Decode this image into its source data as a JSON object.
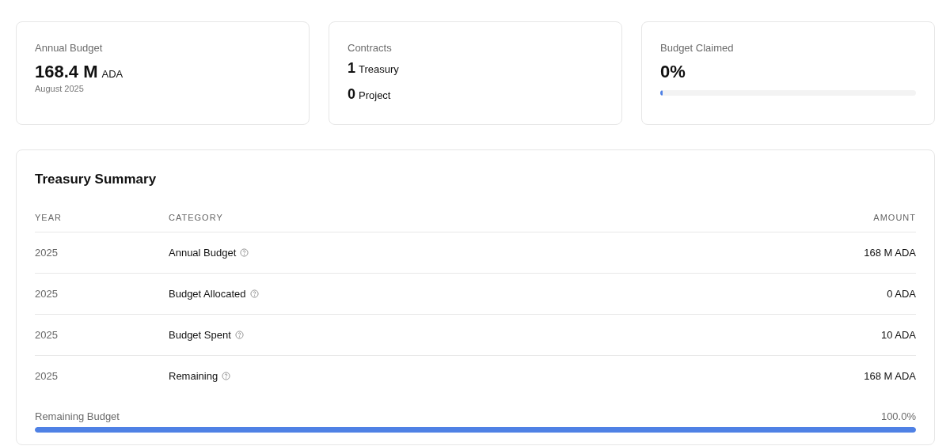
{
  "stats": [
    {
      "kind": "amount",
      "title": "Annual Budget",
      "value": "168.4 M",
      "unit": "ADA",
      "note": "August 2025"
    },
    {
      "kind": "counts",
      "title": "Contracts",
      "counts": [
        {
          "value": "1",
          "label": "Treasury"
        },
        {
          "value": "0",
          "label": "Project"
        }
      ]
    },
    {
      "kind": "progress",
      "title": "Budget Claimed",
      "value": "0%",
      "level": 0.01
    }
  ],
  "summary": {
    "title": "Treasury Summary",
    "columns": [
      "YEAR",
      "CATEGORY",
      "AMOUNT"
    ],
    "rows": [
      {
        "year": "2025",
        "category": "Annual Budget",
        "amount": "168 M ADA"
      },
      {
        "year": "2025",
        "category": "Budget Allocated",
        "amount": "0 ADA"
      },
      {
        "year": "2025",
        "category": "Budget Spent",
        "amount": "10 ADA"
      },
      {
        "year": "2025",
        "category": "Remaining",
        "amount": "168 M ADA"
      }
    ],
    "remaining": {
      "label": "Remaining Budget",
      "reading": "100.0%",
      "level": 1
    }
  }
}
